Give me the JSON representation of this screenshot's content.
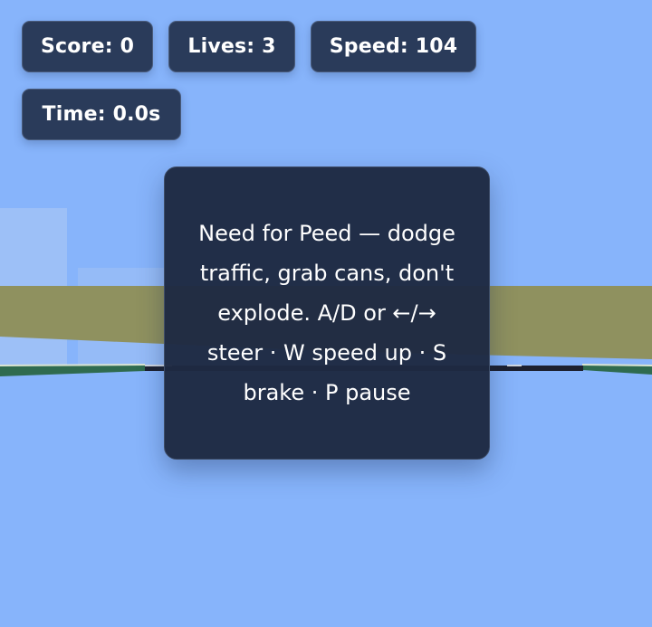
{
  "hud": {
    "score": "Score: 0",
    "lives": "Lives: 3",
    "speed": "Speed: 104",
    "time": "Time: 0.0s"
  },
  "start_overlay": {
    "message": "Need for Peed — dodge traffic, grab cans, don't explode. A/D or ←/→ steer · W speed up · S brake · P pause"
  },
  "colors": {
    "sky": "#87b4fb",
    "hud_chip": "#2a3b5a",
    "overlay_panel": "#1e2942",
    "grass_band": "#8f915f",
    "road": "#1d2130"
  }
}
